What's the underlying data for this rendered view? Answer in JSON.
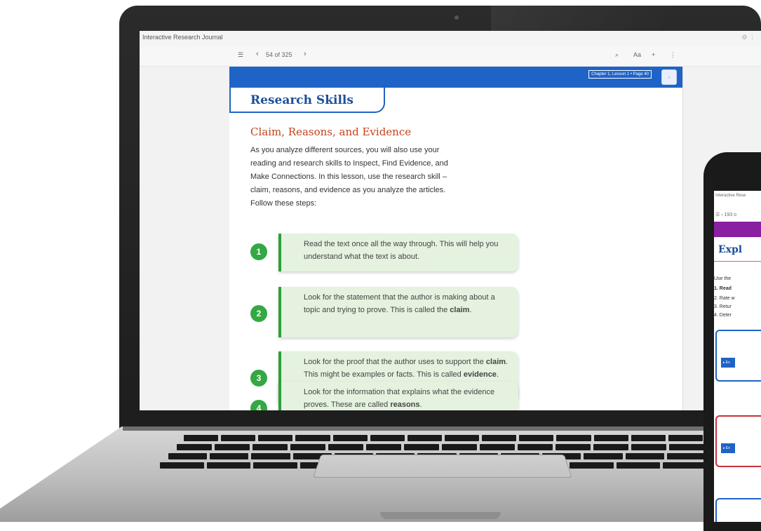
{
  "laptop": {
    "window_title": "Interactive Research Journal",
    "toolbar": {
      "menu_icon": "list-icon",
      "prev_icon": "chevron-left-icon",
      "page_counter": "54 of 325",
      "next_icon": "chevron-right-icon",
      "search_icon": "search-icon",
      "font_size_label": "Aa",
      "add_icon": "plus-icon",
      "more_icon": "more-vertical-icon"
    },
    "page_tag": "Chapter 1, Lesson 1 • Page 40",
    "skills_title": "Research Skills",
    "section_heading": "Claim, Reasons, and Evidence",
    "intro_lines": [
      "As you analyze different sources, you will also use your",
      "reading and research skills to Inspect, Find Evidence, and",
      "Make Connections. In this lesson, use the research skill –",
      "claim, reasons, and evidence as you analyze the articles.",
      "Follow these steps:"
    ],
    "steps": [
      {
        "number": "1",
        "pre": "Read the text once all the way through. This will help you understand what the text is about.",
        "bold": "",
        "post": ""
      },
      {
        "number": "2",
        "pre": "Look for the statement that the author is making about a topic and trying to prove. This is called the ",
        "bold": "claim",
        "post": "."
      },
      {
        "number": "3",
        "pre": "Look for the proof that the author uses to support the ",
        "bold": "claim",
        "mid": ". This might be examples or facts. This is called ",
        "bold2": "evidence",
        "post": "."
      },
      {
        "number": "4",
        "pre": "Look for the information that explains what the evidence proves. These are called ",
        "bold": "reasons",
        "post": "."
      }
    ],
    "colors": {
      "band_blue": "#1f63c6",
      "heading_orange": "#c4421a",
      "step_green": "#33a843",
      "step_bg": "#e4f2df"
    }
  },
  "phone": {
    "window_title": "Interactive Rese",
    "page_counter": "193 o",
    "heading": "Expl",
    "lines": [
      "Use the",
      "1. Read",
      "2. Rate w",
      "3. Retur",
      "4. Deter"
    ],
    "box_button": "▸ Ex",
    "colors": {
      "band_purple": "#8a1fa2"
    }
  }
}
